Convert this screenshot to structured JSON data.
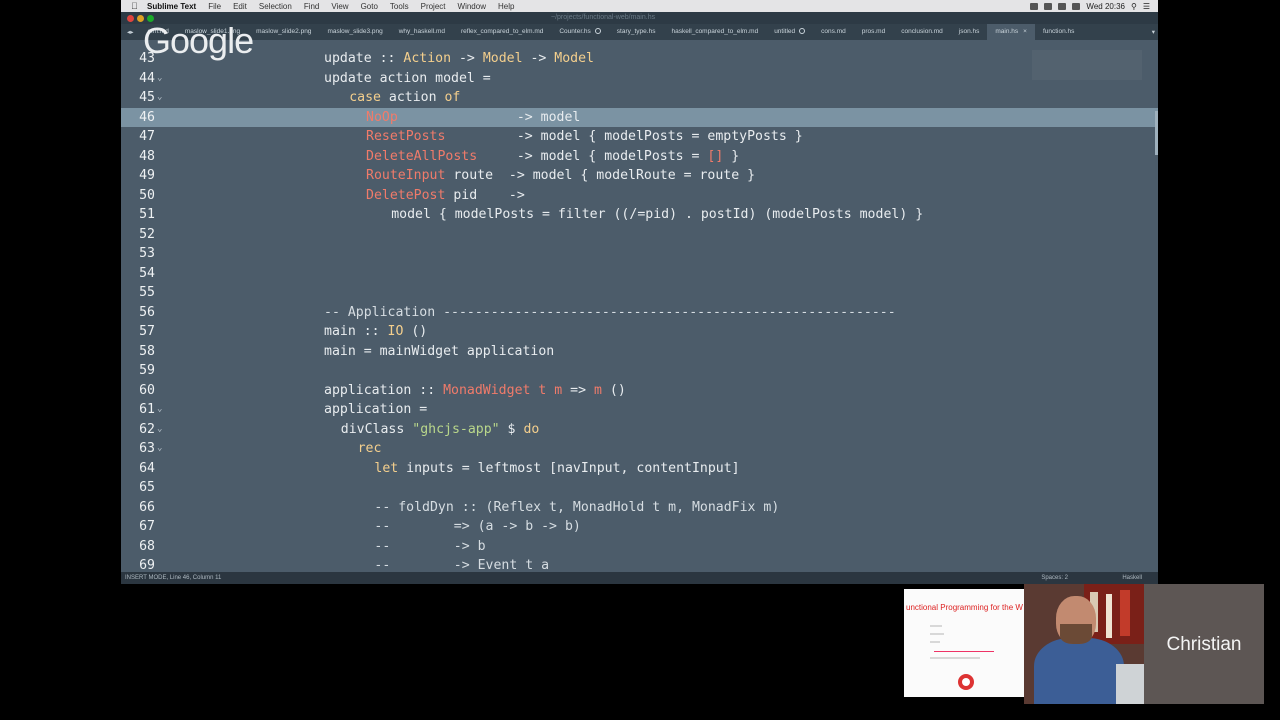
{
  "menubar": {
    "app_name": "Sublime Text",
    "menus": [
      "File",
      "Edit",
      "Selection",
      "Find",
      "View",
      "Goto",
      "Tools",
      "Project",
      "Window",
      "Help"
    ],
    "clock": "Wed 20:36"
  },
  "window": {
    "title": "~/projects/functional-web/main.hs"
  },
  "tabs": [
    {
      "label": "elm.md",
      "active": false,
      "modified": false
    },
    {
      "label": "maslow_slide1.png",
      "active": false,
      "modified": false
    },
    {
      "label": "maslow_slide2.png",
      "active": false,
      "modified": false
    },
    {
      "label": "maslow_slide3.png",
      "active": false,
      "modified": false
    },
    {
      "label": "why_haskell.md",
      "active": false,
      "modified": false
    },
    {
      "label": "reflex_compared_to_elm.md",
      "active": false,
      "modified": false
    },
    {
      "label": "Counter.hs",
      "active": false,
      "modified": true
    },
    {
      "label": "stary_type.hs",
      "active": false,
      "modified": false
    },
    {
      "label": "haskell_compared_to_elm.md",
      "active": false,
      "modified": false
    },
    {
      "label": "untitled",
      "active": false,
      "modified": true
    },
    {
      "label": "cons.md",
      "active": false,
      "modified": false
    },
    {
      "label": "pros.md",
      "active": false,
      "modified": false
    },
    {
      "label": "conclusion.md",
      "active": false,
      "modified": false
    },
    {
      "label": "json.hs",
      "active": false,
      "modified": false
    },
    {
      "label": "main.hs",
      "active": true,
      "modified": false
    },
    {
      "label": "function.hs",
      "active": false,
      "modified": false
    }
  ],
  "google_logo": "Google",
  "code_lines": [
    {
      "n": "43",
      "fold": false,
      "indent": 0,
      "tokens": [
        [
          "fn",
          "update"
        ],
        [
          "op",
          " :: "
        ],
        [
          "type",
          "Action"
        ],
        [
          "op",
          " -> "
        ],
        [
          "type",
          "Model"
        ],
        [
          "op",
          " -> "
        ],
        [
          "type",
          "Model"
        ]
      ]
    },
    {
      "n": "44",
      "fold": true,
      "indent": 0,
      "tokens": [
        [
          "fn",
          "update action model ="
        ]
      ]
    },
    {
      "n": "45",
      "fold": true,
      "indent": 3,
      "tokens": [
        [
          "kw",
          "case"
        ],
        [
          "fn",
          " action "
        ],
        [
          "kw",
          "of"
        ]
      ]
    },
    {
      "n": "46",
      "fold": false,
      "indent": 5,
      "current": true,
      "tokens": [
        [
          "con",
          "NoOp"
        ],
        [
          "op",
          "               -> model"
        ]
      ]
    },
    {
      "n": "47",
      "fold": false,
      "indent": 5,
      "tokens": [
        [
          "con",
          "ResetPosts"
        ],
        [
          "op",
          "         -> model { modelPosts = emptyPosts }"
        ]
      ]
    },
    {
      "n": "48",
      "fold": false,
      "indent": 5,
      "tokens": [
        [
          "con",
          "DeleteAllPosts"
        ],
        [
          "op",
          "     -> model { modelPosts = "
        ],
        [
          "con",
          "[]"
        ],
        [
          "op",
          " }"
        ]
      ]
    },
    {
      "n": "49",
      "fold": false,
      "indent": 5,
      "tokens": [
        [
          "con",
          "RouteInput"
        ],
        [
          "op",
          " route  -> model { modelRoute = route }"
        ]
      ]
    },
    {
      "n": "50",
      "fold": false,
      "indent": 5,
      "tokens": [
        [
          "con",
          "DeletePost"
        ],
        [
          "op",
          " pid    ->"
        ]
      ]
    },
    {
      "n": "51",
      "fold": false,
      "indent": 8,
      "tokens": [
        [
          "op",
          "model { modelPosts = filter ((/=pid) . postId) (modelPosts model) }"
        ]
      ]
    },
    {
      "n": "52",
      "fold": false,
      "indent": 0,
      "tokens": []
    },
    {
      "n": "53",
      "fold": false,
      "indent": 0,
      "tokens": []
    },
    {
      "n": "54",
      "fold": false,
      "indent": 0,
      "tokens": []
    },
    {
      "n": "55",
      "fold": false,
      "indent": 0,
      "tokens": []
    },
    {
      "n": "56",
      "fold": false,
      "indent": 0,
      "tokens": [
        [
          "com",
          "-- Application ---------------------------------------------------------"
        ]
      ]
    },
    {
      "n": "57",
      "fold": false,
      "indent": 0,
      "tokens": [
        [
          "fn",
          "main"
        ],
        [
          "op",
          " :: "
        ],
        [
          "type",
          "IO"
        ],
        [
          "op",
          " ()"
        ]
      ]
    },
    {
      "n": "58",
      "fold": false,
      "indent": 0,
      "tokens": [
        [
          "fn",
          "main = mainWidget application"
        ]
      ]
    },
    {
      "n": "59",
      "fold": false,
      "indent": 0,
      "tokens": []
    },
    {
      "n": "60",
      "fold": false,
      "indent": 0,
      "tokens": [
        [
          "fn",
          "application"
        ],
        [
          "op",
          " :: "
        ],
        [
          "con",
          "MonadWidget"
        ],
        [
          "var",
          " t m"
        ],
        [
          "op",
          " => "
        ],
        [
          "var",
          "m"
        ],
        [
          "op",
          " ()"
        ]
      ]
    },
    {
      "n": "61",
      "fold": true,
      "indent": 0,
      "tokens": [
        [
          "fn",
          "application ="
        ]
      ]
    },
    {
      "n": "62",
      "fold": true,
      "indent": 2,
      "tokens": [
        [
          "op",
          "divClass "
        ],
        [
          "str",
          "\"ghcjs-app\""
        ],
        [
          "op",
          " $ "
        ],
        [
          "kw",
          "do"
        ]
      ]
    },
    {
      "n": "63",
      "fold": true,
      "indent": 4,
      "tokens": [
        [
          "kw",
          "rec"
        ]
      ]
    },
    {
      "n": "64",
      "fold": false,
      "indent": 6,
      "tokens": [
        [
          "kw",
          "let"
        ],
        [
          "op",
          " inputs = leftmost [navInput, contentInput]"
        ]
      ]
    },
    {
      "n": "65",
      "fold": false,
      "indent": 0,
      "tokens": []
    },
    {
      "n": "66",
      "fold": false,
      "indent": 6,
      "tokens": [
        [
          "com",
          "-- foldDyn :: (Reflex t, MonadHold t m, MonadFix m)"
        ]
      ]
    },
    {
      "n": "67",
      "fold": false,
      "indent": 6,
      "tokens": [
        [
          "com",
          "--        => (a -> b -> b)"
        ]
      ]
    },
    {
      "n": "68",
      "fold": false,
      "indent": 6,
      "tokens": [
        [
          "com",
          "--        -> b"
        ]
      ]
    },
    {
      "n": "69",
      "fold": false,
      "indent": 6,
      "tokens": [
        [
          "com",
          "--        -> Event t a"
        ]
      ]
    }
  ],
  "statusbar": {
    "left": "INSERT MODE, Line 46, Column 11",
    "spaces": "Spaces: 2",
    "syntax": "Haskell"
  },
  "video": {
    "slide_title": "unctional Programming for the W",
    "participant_name": "Christian"
  },
  "colors": {
    "editor_bg": "#4c5c6a",
    "current_line": "#7b93a3",
    "constructor": "#f07b6a",
    "type": "#f4cf8d",
    "string": "#b9d78b"
  }
}
